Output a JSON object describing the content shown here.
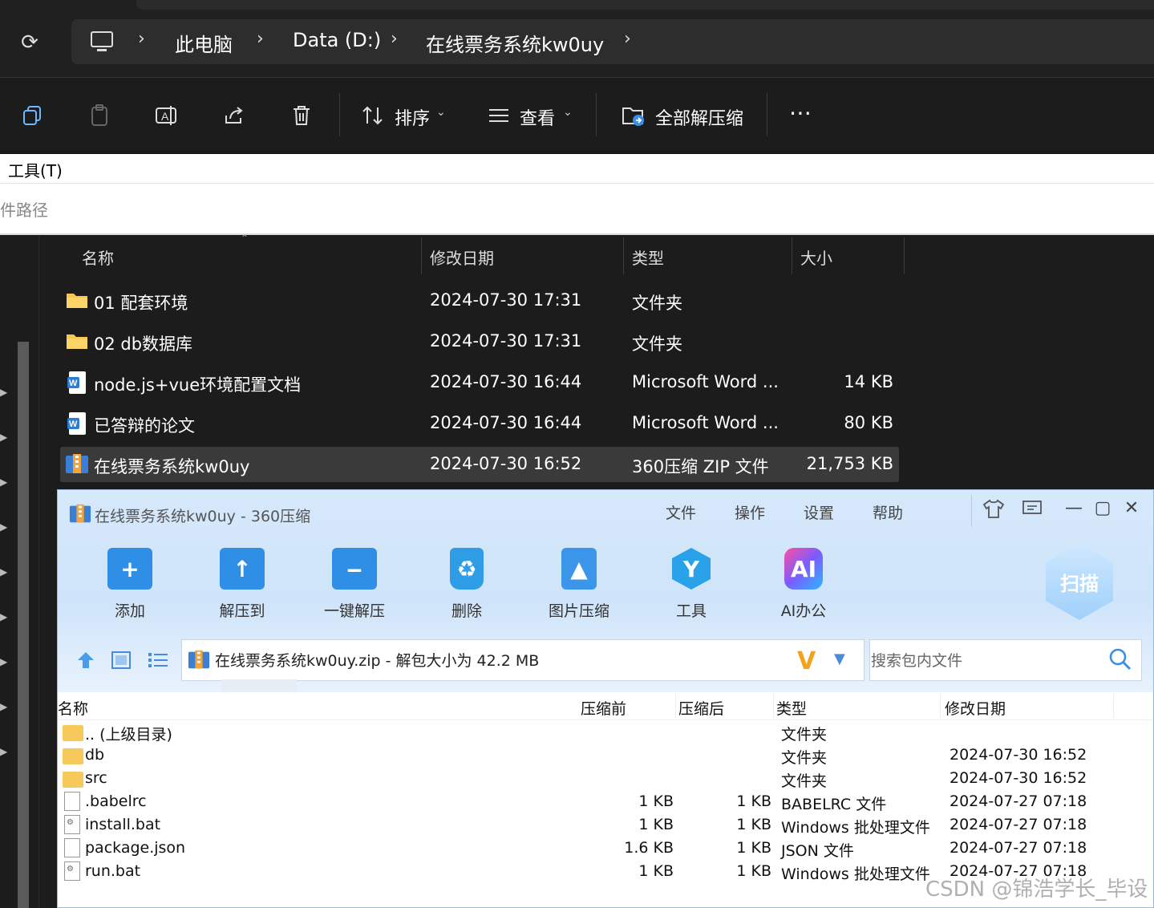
{
  "explorer": {
    "breadcrumb": [
      "此电脑",
      "Data (D:)",
      "在线票务系统kw0uy"
    ],
    "toolbar": {
      "sort_label": "排序",
      "view_label": "查看",
      "extract_all_label": "全部解压缩"
    },
    "menu_tools": "工具(T)",
    "path_hint": "件路径",
    "columns": [
      "名称",
      "修改日期",
      "类型",
      "大小"
    ],
    "rows": [
      {
        "name": "01 配套环境",
        "date": "2024-07-30 17:31",
        "type": "文件夹",
        "size": "",
        "icon": "folder-icon"
      },
      {
        "name": "02 db数据库",
        "date": "2024-07-30 17:31",
        "type": "文件夹",
        "size": "",
        "icon": "folder-icon"
      },
      {
        "name": "node.js+vue环境配置文档",
        "date": "2024-07-30 16:44",
        "type": "Microsoft Word ...",
        "size": "14 KB",
        "icon": "word-doc-icon"
      },
      {
        "name": "已答辩的论文",
        "date": "2024-07-30 16:44",
        "type": "Microsoft Word ...",
        "size": "80 KB",
        "icon": "word-doc-icon"
      },
      {
        "name": "在线票务系统kw0uy",
        "date": "2024-07-30 16:52",
        "type": "360压缩 ZIP 文件",
        "size": "21,753 KB",
        "icon": "zip-archive-icon"
      }
    ]
  },
  "zip": {
    "title": "在线票务系统kw0uy - 360压缩",
    "menu": [
      "文件",
      "操作",
      "设置",
      "帮助"
    ],
    "buttons": [
      "添加",
      "解压到",
      "一键解压",
      "删除",
      "图片压缩",
      "工具",
      "AI办公"
    ],
    "scan_label": "扫描",
    "address": "在线票务系统kw0uy.zip - 解包大小为 42.2 MB",
    "search_placeholder": "搜索包内文件",
    "columns": [
      "名称",
      "压缩前",
      "压缩后",
      "类型",
      "修改日期"
    ],
    "rows": [
      {
        "name": ".. (上级目录)",
        "before": "",
        "after": "",
        "type": "文件夹",
        "date": "",
        "icon": "folder-icon"
      },
      {
        "name": "db",
        "before": "",
        "after": "",
        "type": "文件夹",
        "date": "2024-07-30 16:52",
        "icon": "folder-icon"
      },
      {
        "name": "src",
        "before": "",
        "after": "",
        "type": "文件夹",
        "date": "2024-07-30 16:52",
        "icon": "folder-icon"
      },
      {
        "name": ".babelrc",
        "before": "1 KB",
        "after": "1 KB",
        "type": "BABELRC 文件",
        "date": "2024-07-27 07:18",
        "icon": "file-icon"
      },
      {
        "name": "install.bat",
        "before": "1 KB",
        "after": "1 KB",
        "type": "Windows 批处理文件",
        "date": "2024-07-27 07:18",
        "icon": "batch-file-icon"
      },
      {
        "name": "package.json",
        "before": "1.6 KB",
        "after": "1 KB",
        "type": "JSON 文件",
        "date": "2024-07-27 07:18",
        "icon": "file-icon"
      },
      {
        "name": "run.bat",
        "before": "1 KB",
        "after": "1 KB",
        "type": "Windows 批处理文件",
        "date": "2024-07-27 07:18",
        "icon": "batch-file-icon"
      }
    ]
  },
  "watermark": "CSDN @锦浩学长_毕设"
}
